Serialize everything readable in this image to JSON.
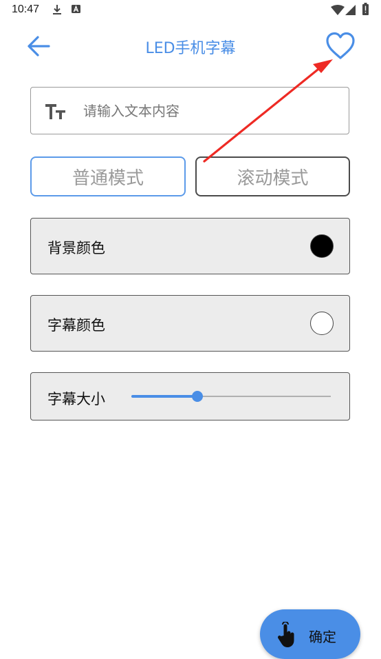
{
  "status_bar": {
    "time": "10:47",
    "icons": [
      "download-icon",
      "a-badge-icon",
      "wifi-icon",
      "signal-icon",
      "battery-icon"
    ]
  },
  "app_bar": {
    "title": "LED手机字幕",
    "back_icon": "arrow-left-icon",
    "favorite_icon": "heart-outline-icon"
  },
  "text_input": {
    "placeholder": "请输入文本内容",
    "value": "",
    "icon": "text-size-icon"
  },
  "modes": {
    "normal_label": "普通模式",
    "scroll_label": "滚动模式"
  },
  "settings": {
    "background_color": {
      "label": "背景颜色",
      "color": "#000000"
    },
    "text_color": {
      "label": "字幕颜色",
      "color": "#ffffff"
    },
    "text_size": {
      "label": "字幕大小",
      "level": 0.33
    }
  },
  "confirm": {
    "label": "确定",
    "icon": "touch-hand-icon"
  },
  "colors": {
    "accent": "#4a8ee6",
    "annotation": "#ee2a24"
  }
}
